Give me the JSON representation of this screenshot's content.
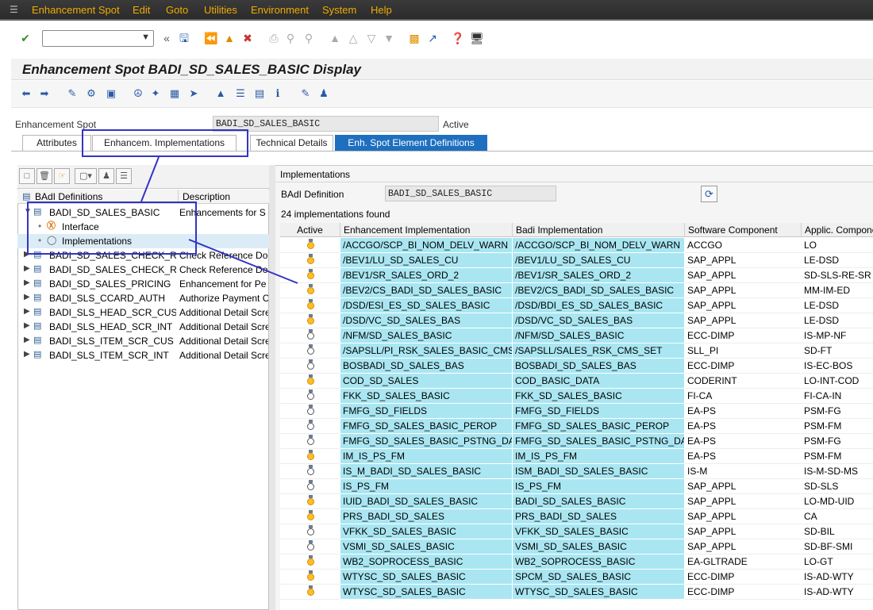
{
  "menubar": {
    "items": [
      "Enhancement Spot",
      "Edit",
      "Goto",
      "Utilities",
      "Environment",
      "System",
      "Help"
    ]
  },
  "toolbar": {
    "command_field_value": "",
    "icons": [
      "enter-icon",
      "back-icon",
      "save-icon",
      "back-nav-icon",
      "exit-icon",
      "cancel-icon",
      "print-icon",
      "find-icon",
      "find-next-icon",
      "first-page-icon",
      "previous-page-icon",
      "next-page-icon",
      "last-page-icon",
      "create-session-icon",
      "shortcut-icon",
      "help-icon",
      "customize-layout-icon"
    ]
  },
  "title": "Enhancement Spot BADI_SD_SALES_BASIC Display",
  "header": {
    "spot_label": "Enhancement Spot",
    "spot_value": "BADI_SD_SALES_BASIC",
    "status": "Active"
  },
  "tabs": [
    {
      "label": "Attributes",
      "active": false
    },
    {
      "label": "Enhancem. Implementations",
      "active": false
    },
    {
      "label": "Technical Details",
      "active": false
    },
    {
      "label": "Enh. Spot Element Definitions",
      "active": true
    }
  ],
  "tree": {
    "col_definitions": "BAdI Definitions",
    "col_description": "Description",
    "rows": [
      {
        "name": "BADI_SD_SALES_BASIC",
        "desc": "Enhancements for S",
        "level": 0,
        "expanded": true
      },
      {
        "name": "Interface",
        "desc": "",
        "level": 1
      },
      {
        "name": "Implementations",
        "desc": "",
        "level": 1,
        "selected": true
      },
      {
        "name": "BADI_SD_SALES_CHECK_REF",
        "desc": "Check Reference Do",
        "level": 0
      },
      {
        "name": "BADI_SD_SALES_CHECK_REF",
        "desc": "Check Reference Do",
        "level": 0
      },
      {
        "name": "BADI_SD_SALES_PRICING",
        "desc": "Enhancement for Pe",
        "level": 0
      },
      {
        "name": "BADI_SLS_CCARD_AUTH",
        "desc": "Authorize Payment C",
        "level": 0
      },
      {
        "name": "BADI_SLS_HEAD_SCR_CUS",
        "desc": "Additional Detail Scre",
        "level": 0
      },
      {
        "name": "BADI_SLS_HEAD_SCR_INT",
        "desc": "Additional Detail Scre",
        "level": 0
      },
      {
        "name": "BADI_SLS_ITEM_SCR_CUS",
        "desc": "Additional Detail Scre",
        "level": 0
      },
      {
        "name": "BADI_SLS_ITEM_SCR_INT",
        "desc": "Additional Detail Scre",
        "level": 0
      }
    ]
  },
  "implementations": {
    "title": "Implementations",
    "badi_label": "BAdI Definition",
    "badi_value": "BADI_SD_SALES_BASIC",
    "count_text": "24  implementations found",
    "columns": [
      "Active",
      "Enhancement Implementation",
      "Badi Implementation",
      "Software Component",
      "Applic. Component"
    ],
    "rows": [
      {
        "active": true,
        "enh": "/ACCGO/SCP_BI_NOM_DELV_WARN",
        "badi": "/ACCGO/SCP_BI_NOM_DELV_WARN",
        "sw": "ACCGO",
        "app": "LO"
      },
      {
        "active": true,
        "enh": "/BEV1/LU_SD_SALES_CU",
        "badi": "/BEV1/LU_SD_SALES_CU",
        "sw": "SAP_APPL",
        "app": "LE-DSD"
      },
      {
        "active": true,
        "enh": "/BEV1/SR_SALES_ORD_2",
        "badi": "/BEV1/SR_SALES_ORD_2",
        "sw": "SAP_APPL",
        "app": "SD-SLS-RE-SR"
      },
      {
        "active": true,
        "enh": "/BEV2/CS_BADI_SD_SALES_BASIC",
        "badi": "/BEV2/CS_BADI_SD_SALES_BASIC",
        "sw": "SAP_APPL",
        "app": "MM-IM-ED"
      },
      {
        "active": true,
        "enh": "/DSD/ESI_ES_SD_SALES_BASIC",
        "badi": "/DSD/BDI_ES_SD_SALES_BASIC",
        "sw": "SAP_APPL",
        "app": "LE-DSD"
      },
      {
        "active": true,
        "enh": "/DSD/VC_SD_SALES_BAS",
        "badi": "/DSD/VC_SD_SALES_BAS",
        "sw": "SAP_APPL",
        "app": "LE-DSD"
      },
      {
        "active": false,
        "enh": "/NFM/SD_SALES_BASIC",
        "badi": "/NFM/SD_SALES_BASIC",
        "sw": "ECC-DIMP",
        "app": "IS-MP-NF"
      },
      {
        "active": false,
        "enh": "/SAPSLL/PI_RSK_SALES_BASIC_CMS",
        "badi": "/SAPSLL/SALES_RSK_CMS_SET",
        "sw": "SLL_PI",
        "app": "SD-FT"
      },
      {
        "active": false,
        "enh": "BOSBADI_SD_SALES_BAS",
        "badi": "BOSBADI_SD_SALES_BAS",
        "sw": "ECC-DIMP",
        "app": "IS-EC-BOS"
      },
      {
        "active": true,
        "enh": "COD_SD_SALES",
        "badi": "COD_BASIC_DATA",
        "sw": "CODERINT",
        "app": "LO-INT-COD"
      },
      {
        "active": false,
        "enh": "FKK_SD_SALES_BASIC",
        "badi": "FKK_SD_SALES_BASIC",
        "sw": "FI-CA",
        "app": "FI-CA-IN"
      },
      {
        "active": false,
        "enh": "FMFG_SD_FIELDS",
        "badi": "FMFG_SD_FIELDS",
        "sw": "EA-PS",
        "app": "PSM-FG"
      },
      {
        "active": false,
        "enh": "FMFG_SD_SALES_BASIC_PEROP",
        "badi": "FMFG_SD_SALES_BASIC_PEROP",
        "sw": "EA-PS",
        "app": "PSM-FM"
      },
      {
        "active": false,
        "enh": "FMFG_SD_SALES_BASIC_PSTNG_DA...",
        "badi": "FMFG_SD_SALES_BASIC_PSTNG_DA...",
        "sw": "EA-PS",
        "app": "PSM-FG"
      },
      {
        "active": true,
        "enh": "IM_IS_PS_FM",
        "badi": "IM_IS_PS_FM",
        "sw": "EA-PS",
        "app": "PSM-FM"
      },
      {
        "active": false,
        "enh": "IS_M_BADI_SD_SALES_BASIC",
        "badi": "ISM_BADI_SD_SALES_BASIC",
        "sw": "IS-M",
        "app": "IS-M-SD-MS"
      },
      {
        "active": false,
        "enh": "IS_PS_FM",
        "badi": "IS_PS_FM",
        "sw": "SAP_APPL",
        "app": "SD-SLS"
      },
      {
        "active": true,
        "enh": "IUID_BADI_SD_SALES_BASIC",
        "badi": "BADI_SD_SALES_BASIC",
        "sw": "SAP_APPL",
        "app": "LO-MD-UID"
      },
      {
        "active": true,
        "enh": "PRS_BADI_SD_SALES",
        "badi": "PRS_BADI_SD_SALES",
        "sw": "SAP_APPL",
        "app": "CA"
      },
      {
        "active": false,
        "enh": "VFKK_SD_SALES_BASIC",
        "badi": "VFKK_SD_SALES_BASIC",
        "sw": "SAP_APPL",
        "app": "SD-BIL"
      },
      {
        "active": false,
        "enh": "VSMI_SD_SALES_BASIC",
        "badi": "VSMI_SD_SALES_BASIC",
        "sw": "SAP_APPL",
        "app": "SD-BF-SMI"
      },
      {
        "active": true,
        "enh": "WB2_SOPROCESS_BASIC",
        "badi": "WB2_SOPROCESS_BASIC",
        "sw": "EA-GLTRADE",
        "app": "LO-GT"
      },
      {
        "active": true,
        "enh": "WTYSC_SD_SALES_BASIC",
        "badi": "SPCM_SD_SALES_BASIC",
        "sw": "ECC-DIMP",
        "app": "IS-AD-WTY"
      },
      {
        "active": true,
        "enh": "WTYSC_SD_SALES_BASIC",
        "badi": "WTYSC_SD_SALES_BASIC",
        "sw": "ECC-DIMP",
        "app": "IS-AD-WTY"
      }
    ]
  },
  "colors": {
    "menu_text": "#f0ab00",
    "active_tab": "#1e6fbf",
    "cell_highlight": "#a9e6f2",
    "annotation": "#3434c4"
  }
}
